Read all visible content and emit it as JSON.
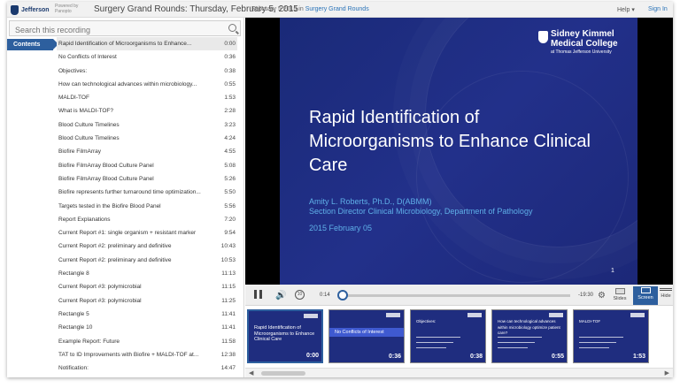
{
  "header": {
    "logo_text": "Jefferson",
    "powered_by": "Powered by Panopto",
    "title": "Surgery Grand Rounds: Thursday, February 5, 2015",
    "meta_date": "February 5 2015 in",
    "meta_folder": "Surgery Grand Rounds",
    "help_label": "Help",
    "signin_label": "Sign In"
  },
  "search": {
    "placeholder": "Search this recording"
  },
  "contents_tab": "Contents",
  "toc": [
    {
      "title": "Rapid Identification of Microorganisms to Enhance...",
      "time": "0:00"
    },
    {
      "title": "No Conflicts of Interest",
      "time": "0:36"
    },
    {
      "title": "Objectives:",
      "time": "0:38"
    },
    {
      "title": "How can technological advances within microbiology...",
      "time": "0:55"
    },
    {
      "title": "MALDI-TOF",
      "time": "1:53"
    },
    {
      "title": "What is MALDI-TOF?",
      "time": "2:28"
    },
    {
      "title": "Blood Culture Timelines",
      "time": "3:23"
    },
    {
      "title": "Blood Culture Timelines",
      "time": "4:24"
    },
    {
      "title": "Biofire FilmArray",
      "time": "4:55"
    },
    {
      "title": "Biofire FilmArray Blood Culture Panel",
      "time": "5:08"
    },
    {
      "title": "Biofire FilmArray Blood Culture Panel",
      "time": "5:26"
    },
    {
      "title": "Biofire represents further turnaround time optimization...",
      "time": "5:50"
    },
    {
      "title": "Targets tested in the Biofire Blood Panel",
      "time": "5:56"
    },
    {
      "title": "Report Explanations",
      "time": "7:20"
    },
    {
      "title": "Current Report #1: single organism + resistant marker",
      "time": "9:54"
    },
    {
      "title": "Current Report #2: preliminary and definitive",
      "time": "10:43"
    },
    {
      "title": "Current Report #2: preliminary and definitive",
      "time": "10:53"
    },
    {
      "title": "Rectangle 8",
      "time": "11:13"
    },
    {
      "title": "Current Report #3: polymicrobial",
      "time": "11:15"
    },
    {
      "title": "Current Report #3: polymicrobial",
      "time": "11:25"
    },
    {
      "title": "Rectangle 5",
      "time": "11:41"
    },
    {
      "title": "Rectangle 10",
      "time": "11:41"
    },
    {
      "title": "Example Report: Future",
      "time": "11:58"
    },
    {
      "title": "TAT to ID Improvements with Biofire + MALDI-TOF at...",
      "time": "12:38"
    },
    {
      "title": "Notification:",
      "time": "14:47"
    }
  ],
  "slide": {
    "org_line1": "Sidney Kimmel",
    "org_line2": "Medical College",
    "org_line3": "at Thomas Jefferson University",
    "title": "Rapid Identification of Microorganisms to Enhance Clinical Care",
    "author_line1": "Amity L. Roberts, Ph.D., D(ABMM)",
    "author_line2": "Section Director Clinical Microbiology, Department of Pathology",
    "date": "2015 February 05",
    "page_number": "1"
  },
  "player": {
    "elapsed": "0:14",
    "remaining": "-19:30",
    "progress_fraction": 0.01,
    "slides_label": "Slides",
    "screen_label": "Screen",
    "hide_label": "Hide"
  },
  "thumbnails": [
    {
      "title": "Rapid Identification of Microorganisms to Enhance Clinical Care",
      "time": "0:00"
    },
    {
      "title": "No Conflicts of Interest",
      "time": "0:36"
    },
    {
      "title": "Objectives:",
      "time": "0:38"
    },
    {
      "title": "How can technological advances within microbiology optimize patient care?",
      "time": "0:55"
    },
    {
      "title": "MALDI-TOF",
      "time": "1:53"
    }
  ],
  "colors": {
    "accent": "#2d5f9e",
    "slide_bg": "#1f2d7f",
    "slide_text_accent": "#5fb0e8"
  }
}
